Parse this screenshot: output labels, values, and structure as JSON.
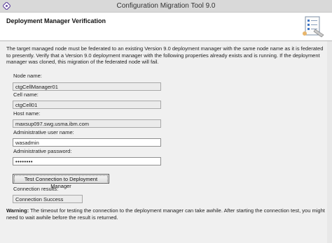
{
  "window": {
    "title": "Configuration Migration Tool 9.0"
  },
  "header": {
    "title": "Deployment Manager Verification",
    "icon": "checklist-icon"
  },
  "intro_text": "The target managed node must be federated to an existing Version 9.0 deployment manager with the same node name as it is federated to presently. Verify that a Version 9.0 deployment manager with the following properties already exists and is running. If the deployment manager was cloned, this migration of the federated node will fail.",
  "fields": {
    "node_name": {
      "label": "Node name:",
      "value": "ctgCellManager01"
    },
    "cell_name": {
      "label": "Cell name:",
      "value": "ctgCell01"
    },
    "host_name": {
      "label": "Host name:",
      "value": "maxsup097.swg.usma.ibm.com"
    },
    "admin_user": {
      "label": "Administrative user name:",
      "value": "wasadmin"
    },
    "admin_password": {
      "label": "Administrative password:",
      "value": "••••••••"
    }
  },
  "test_button": {
    "label": "Test Connection to Deployment Manager"
  },
  "connection_results": {
    "label": "Connection results:",
    "value": "Connection Success"
  },
  "warning": {
    "label": "Warning:",
    "text": " The timeout for testing the connection to the deployment manager can take awhile. After starting the connection test, you might need to wait awhile before the result is returned."
  }
}
